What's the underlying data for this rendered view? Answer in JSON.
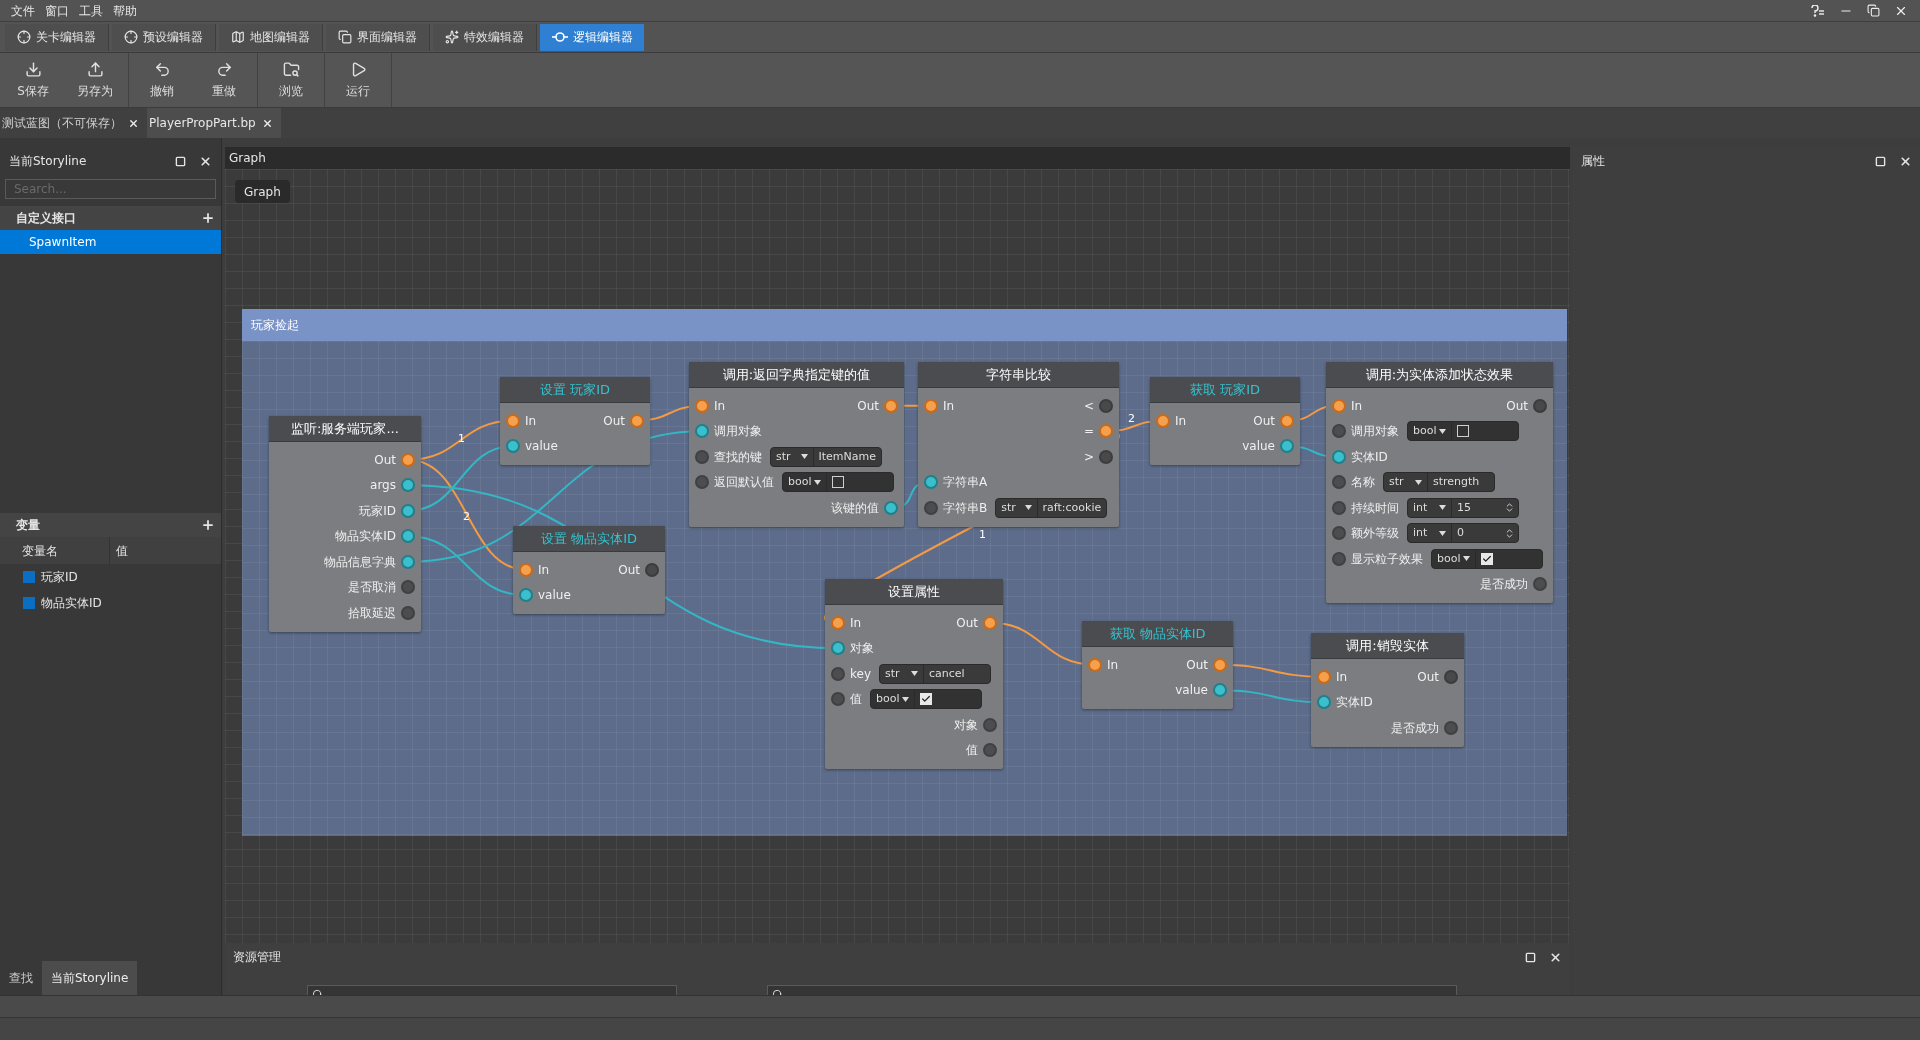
{
  "menu": [
    "文件",
    "窗口",
    "工具",
    "帮助"
  ],
  "editor_tabs": [
    {
      "label": "关卡编辑器",
      "selected": false
    },
    {
      "label": "预设编辑器",
      "selected": false
    },
    {
      "label": "地图编辑器",
      "selected": false
    },
    {
      "label": "界面编辑器",
      "selected": false
    },
    {
      "label": "特效编辑器",
      "selected": false
    },
    {
      "label": "逻辑编辑器",
      "selected": true
    }
  ],
  "toolbar": [
    [
      "S保存",
      "另存为"
    ],
    [
      "撤销",
      "重做"
    ],
    [
      "浏览"
    ],
    [
      "运行"
    ]
  ],
  "documents": [
    {
      "label": "测试蓝图（不可保存）",
      "selected": false
    },
    {
      "label": "PlayerPropPart.bp",
      "selected": true
    }
  ],
  "storyline_panel": {
    "title": "当前Storyline",
    "search": {
      "placeholder": "Search..."
    },
    "interfaces": {
      "title": "自定义接口",
      "items": [
        {
          "label": "SpawnItem",
          "selected": true
        }
      ]
    },
    "variables": {
      "title": "变量",
      "columns": [
        "变量名",
        "值"
      ],
      "rows": [
        "玩家ID",
        "物品实体ID"
      ]
    },
    "bottom_tabs": [
      {
        "label": "查找",
        "selected": false
      },
      {
        "label": "当前Storyline",
        "selected": true
      }
    ]
  },
  "graph": {
    "title": "Graph",
    "breadcrumb": "Graph",
    "group": {
      "title": "玩家捡起"
    },
    "wire_labels": [
      "1",
      "2",
      "2",
      "1"
    ],
    "nodes": [
      {
        "title": "监听:服务端玩家...",
        "kind": "event",
        "rows": [
          {
            "out": {
              "label": "Out",
              "kind": "exec",
              "connected": true
            }
          },
          {
            "out": {
              "label": "args",
              "kind": "data",
              "connected": true
            }
          },
          {
            "out": {
              "label": "玩家ID",
              "kind": "data",
              "connected": true
            }
          },
          {
            "out": {
              "label": "物品实体ID",
              "kind": "data",
              "connected": true
            }
          },
          {
            "out": {
              "label": "物品信息字典",
              "kind": "data",
              "connected": true
            }
          },
          {
            "out": {
              "label": "是否取消",
              "kind": "data",
              "connected": false
            }
          },
          {
            "out": {
              "label": "拾取延迟",
              "kind": "data",
              "connected": false
            }
          }
        ]
      },
      {
        "title": "设置 玩家ID",
        "kind": "variable",
        "rows": [
          {
            "in": {
              "label": "In",
              "kind": "exec",
              "connected": true
            },
            "out": {
              "label": "Out",
              "kind": "exec",
              "connected": true
            }
          },
          {
            "in": {
              "label": "value",
              "kind": "data",
              "connected": true
            }
          }
        ]
      },
      {
        "title": "调用:返回字典指定键的值",
        "kind": "call",
        "rows": [
          {
            "in": {
              "label": "In",
              "kind": "exec",
              "connected": true
            },
            "out": {
              "label": "Out",
              "kind": "exec",
              "connected": true
            }
          },
          {
            "in": {
              "label": "调用对象",
              "kind": "data",
              "connected": true
            }
          },
          {
            "in": {
              "label": "查找的键",
              "kind": "data",
              "connected": false
            },
            "input": {
              "kind": "text",
              "type_label": "str",
              "value": "ItemName"
            }
          },
          {
            "in": {
              "label": "返回默认值",
              "kind": "data",
              "connected": false
            },
            "input": {
              "kind": "checkbox",
              "type_label": "bool",
              "checked": false
            }
          },
          {
            "out": {
              "label": "该键的值",
              "kind": "data",
              "connected": true
            }
          }
        ]
      },
      {
        "title": "字符串比较",
        "kind": "call",
        "rows": [
          {
            "in": {
              "label": "In",
              "kind": "exec",
              "connected": true
            },
            "out": {
              "label": "<",
              "kind": "exec",
              "connected": false
            }
          },
          {
            "out": {
              "label": "=",
              "kind": "exec",
              "connected": true
            }
          },
          {
            "out": {
              "label": ">",
              "kind": "exec",
              "connected": false
            }
          },
          {
            "in": {
              "label": "字符串A",
              "kind": "data",
              "connected": true
            }
          },
          {
            "in": {
              "label": "字符串B",
              "kind": "data",
              "connected": false
            },
            "input": {
              "kind": "text",
              "type_label": "str",
              "value": "raft:cookie"
            }
          }
        ]
      },
      {
        "title": "获取 玩家ID",
        "kind": "variable",
        "rows": [
          {
            "in": {
              "label": "In",
              "kind": "exec",
              "connected": true
            },
            "out": {
              "label": "Out",
              "kind": "exec",
              "connected": true
            }
          },
          {
            "out": {
              "label": "value",
              "kind": "data",
              "connected": true
            }
          }
        ]
      },
      {
        "title": "调用:为实体添加状态效果",
        "kind": "call",
        "rows": [
          {
            "in": {
              "label": "In",
              "kind": "exec",
              "connected": true
            },
            "out": {
              "label": "Out",
              "kind": "exec",
              "connected": false
            }
          },
          {
            "in": {
              "label": "调用对象",
              "kind": "data",
              "connected": false
            },
            "input": {
              "kind": "checkbox",
              "type_label": "bool",
              "checked": false
            }
          },
          {
            "in": {
              "label": "实体ID",
              "kind": "data",
              "connected": true
            }
          },
          {
            "in": {
              "label": "名称",
              "kind": "data",
              "connected": false
            },
            "input": {
              "kind": "text",
              "type_label": "str",
              "value": "strength"
            }
          },
          {
            "in": {
              "label": "持续时间",
              "kind": "data",
              "connected": false
            },
            "input": {
              "kind": "spinner",
              "type_label": "int",
              "value": "15"
            }
          },
          {
            "in": {
              "label": "额外等级",
              "kind": "data",
              "connected": false
            },
            "input": {
              "kind": "spinner",
              "type_label": "int",
              "value": "0"
            }
          },
          {
            "in": {
              "label": "显示粒子效果",
              "kind": "data",
              "connected": false
            },
            "input": {
              "kind": "checkbox",
              "type_label": "bool",
              "checked": true
            }
          },
          {
            "out": {
              "label": "是否成功",
              "kind": "data",
              "connected": false
            }
          }
        ]
      },
      {
        "title": "设置 物品实体ID",
        "kind": "variable",
        "rows": [
          {
            "in": {
              "label": "In",
              "kind": "exec",
              "connected": true
            },
            "out": {
              "label": "Out",
              "kind": "exec",
              "connected": false
            }
          },
          {
            "in": {
              "label": "value",
              "kind": "data",
              "connected": true
            }
          }
        ]
      },
      {
        "title": "设置属性",
        "kind": "call",
        "rows": [
          {
            "in": {
              "label": "In",
              "kind": "exec",
              "connected": true
            },
            "out": {
              "label": "Out",
              "kind": "exec",
              "connected": true
            }
          },
          {
            "in": {
              "label": "对象",
              "kind": "data",
              "connected": true
            }
          },
          {
            "in": {
              "label": "key",
              "kind": "data",
              "connected": false
            },
            "input": {
              "kind": "text",
              "type_label": "str",
              "value": "cancel"
            }
          },
          {
            "in": {
              "label": "值",
              "kind": "data",
              "connected": false
            },
            "input": {
              "kind": "checkbox",
              "type_label": "bool",
              "checked": true
            }
          },
          {
            "out": {
              "label": "对象",
              "kind": "data",
              "connected": false
            }
          },
          {
            "out": {
              "label": "值",
              "kind": "data",
              "connected": false
            }
          }
        ]
      },
      {
        "title": "获取 物品实体ID",
        "kind": "variable",
        "rows": [
          {
            "in": {
              "label": "In",
              "kind": "exec",
              "connected": true
            },
            "out": {
              "label": "Out",
              "kind": "exec",
              "connected": true
            }
          },
          {
            "out": {
              "label": "value",
              "kind": "data",
              "connected": true
            }
          }
        ]
      },
      {
        "title": "调用:销毁实体",
        "kind": "call",
        "rows": [
          {
            "in": {
              "label": "In",
              "kind": "exec",
              "connected": true
            },
            "out": {
              "label": "Out",
              "kind": "exec",
              "connected": false
            }
          },
          {
            "in": {
              "label": "实体ID",
              "kind": "data",
              "connected": true
            }
          },
          {
            "out": {
              "label": "是否成功",
              "kind": "data",
              "connected": false
            }
          }
        ]
      }
    ]
  },
  "properties_panel": {
    "title": "属性"
  },
  "assets_panel": {
    "title": "资源管理"
  }
}
